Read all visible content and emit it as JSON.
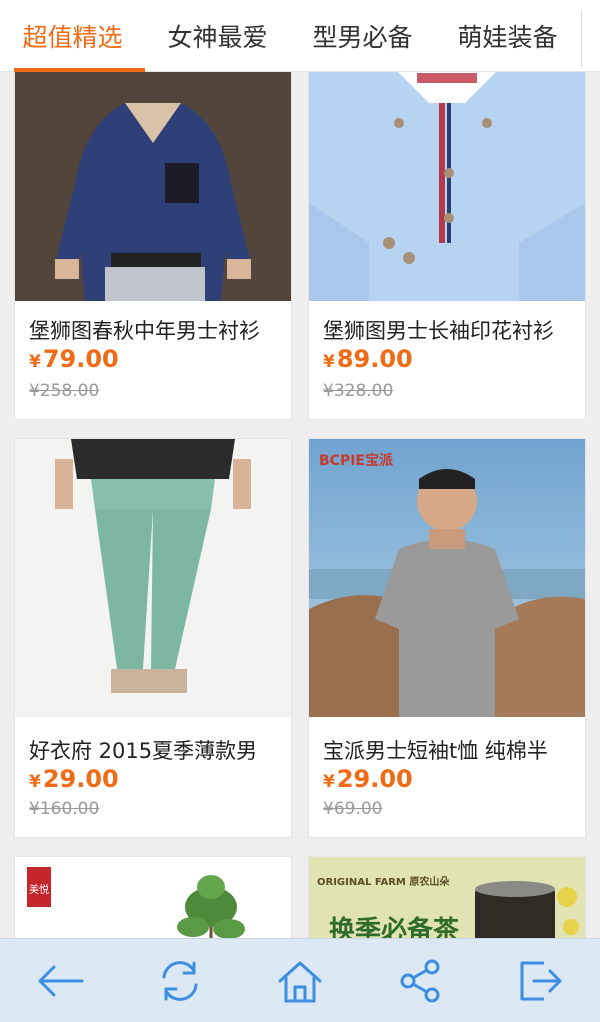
{
  "tabs": [
    {
      "label": "超值精选",
      "active": true
    },
    {
      "label": "女神最爱",
      "active": false
    },
    {
      "label": "型男必备",
      "active": false
    },
    {
      "label": "萌娃装备",
      "active": false
    }
  ],
  "products": [
    {
      "title": "堡狮图春秋中年男士衬衫",
      "currency": "¥",
      "price": "79.00",
      "original_price": "¥258.00",
      "image": "plaid-shirt-model"
    },
    {
      "title": "堡狮图男士长袖印花衬衫",
      "currency": "¥",
      "price": "89.00",
      "original_price": "¥328.00",
      "image": "blue-dotted-shirt"
    },
    {
      "title": "好衣府 2015夏季薄款男",
      "currency": "¥",
      "price": "29.00",
      "original_price": "¥160.00",
      "image": "green-pants-model"
    },
    {
      "title": "宝派男士短袖t恤 纯棉半",
      "currency": "¥",
      "price": "29.00",
      "original_price": "¥69.00",
      "image": "gray-tshirt-model",
      "image_brand_text": "BCPIE宝派"
    },
    {
      "title": "",
      "image": "plant-decor",
      "image_stamp_text": "美悦"
    },
    {
      "title": "",
      "image": "tea-promo",
      "image_banner_text": "换季必备茶",
      "image_brand_text": "ORIGINAL FARM 原农山朵"
    }
  ],
  "bottom_nav": [
    {
      "icon": "back-arrow-icon"
    },
    {
      "icon": "refresh-icon"
    },
    {
      "icon": "home-icon"
    },
    {
      "icon": "share-icon"
    },
    {
      "icon": "exit-icon"
    }
  ],
  "colors": {
    "accent": "#f06b16",
    "nav_bg": "#dde8f5",
    "nav_icon": "#3b8ee0"
  }
}
